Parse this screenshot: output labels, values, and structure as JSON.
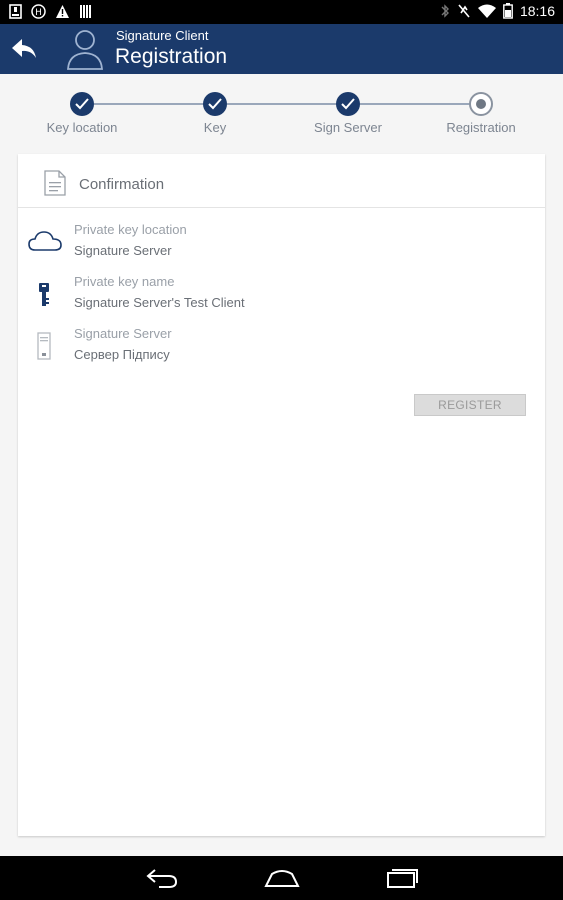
{
  "status_bar": {
    "time": "18:16",
    "left_icons": [
      "notification-download-icon",
      "notification-h-icon",
      "warning-icon",
      "barcode-icon"
    ],
    "right_icons": [
      "vibrate-icon",
      "bluetooth-off-icon",
      "wifi-icon",
      "battery-icon"
    ]
  },
  "app_bar": {
    "subtitle": "Signature Client",
    "title": "Registration",
    "accent_color": "#1b3a6b"
  },
  "stepper": {
    "steps": [
      {
        "label": "Key location",
        "state": "done"
      },
      {
        "label": "Key",
        "state": "done"
      },
      {
        "label": "Sign Server",
        "state": "done"
      },
      {
        "label": "Registration",
        "state": "current"
      }
    ]
  },
  "card": {
    "title": "Confirmation",
    "rows": [
      {
        "icon": "cloud-icon",
        "label": "Private key location",
        "value": "Signature Server"
      },
      {
        "icon": "key-icon",
        "label": "Private key name",
        "value": "Signature Server's Test Client"
      },
      {
        "icon": "server-icon",
        "label": "Signature Server",
        "value": "Сервер Підпису"
      }
    ],
    "register_label": "REGISTER"
  },
  "nav_bar": {
    "buttons": [
      "back-nav-icon",
      "home-nav-icon",
      "recents-nav-icon"
    ]
  }
}
